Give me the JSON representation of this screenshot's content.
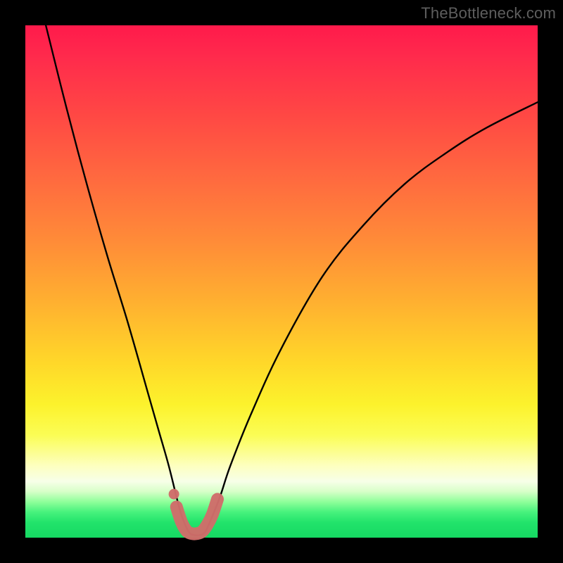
{
  "watermark": "TheBottleneck.com",
  "chart_data": {
    "type": "line",
    "title": "",
    "xlabel": "",
    "ylabel": "",
    "xlim": [
      0,
      100
    ],
    "ylim": [
      0,
      100
    ],
    "series": [
      {
        "name": "bottleneck-curve",
        "x": [
          4,
          8,
          12,
          16,
          20,
          24,
          26,
          28,
          30,
          31,
          32,
          33,
          34,
          35,
          36,
          38,
          40,
          44,
          50,
          58,
          66,
          74,
          82,
          90,
          100
        ],
        "values": [
          100,
          84,
          69,
          55,
          42,
          28,
          21,
          14,
          6,
          3,
          1,
          0.5,
          0.5,
          1,
          3,
          8,
          14,
          24,
          37,
          51,
          61,
          69,
          75,
          80,
          85
        ]
      },
      {
        "name": "highlight-band",
        "x": [
          29.5,
          30.5,
          31.5,
          32.5,
          33.5,
          34.5,
          35.5,
          36.5,
          37.5
        ],
        "values": [
          6.0,
          3.0,
          1.3,
          0.8,
          0.8,
          1.2,
          2.5,
          4.5,
          7.5
        ]
      },
      {
        "name": "highlight-dot",
        "x": [
          29.0
        ],
        "values": [
          8.5
        ]
      }
    ],
    "colors": {
      "curve": "#000000",
      "highlight": "#cf6d6a",
      "gradient_top": "#ff1a4b",
      "gradient_mid": "#ffd829",
      "gradient_bottom": "#15d862"
    }
  }
}
